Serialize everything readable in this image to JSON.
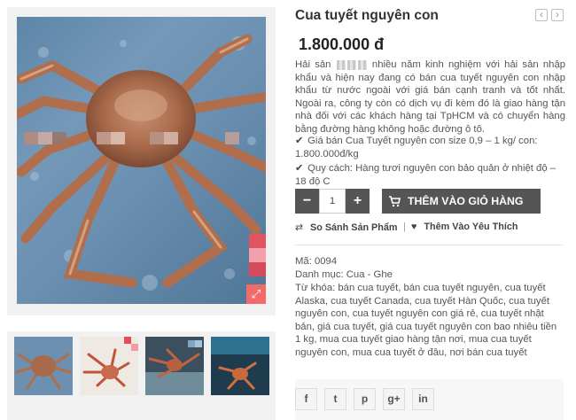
{
  "product": {
    "title": "Cua tuyết nguyên con",
    "price": "1.800.000 đ",
    "nav": {
      "prev": "‹",
      "next": "›"
    }
  },
  "description": {
    "part1": "Hải sản",
    "part2": "nhiều năm kinh nghiệm với hải sản nhập khẩu và hiện nay đang có bán cua tuyết nguyên con nhập khẩu từ nước ngoài với giá bán cạnh tranh và tốt nhất. Ngoài ra, công ty còn có dịch vụ đi kèm đó là giao hàng tận nhà đối với các khách hàng tại TpHCM và có chuyển hàng bằng đường hàng không hoặc đường ô tô."
  },
  "bullets": [
    {
      "icon": "check-icon",
      "text": "Giá bán Cua Tuyết nguyên con size 0,9 – 1 kg/ con: 1.800.000đ/kg"
    },
    {
      "icon": "check-icon",
      "text": "Quy cách: Hàng tươi nguyên con bảo quản ở nhiệt độ – 18 độ C"
    }
  ],
  "cart": {
    "minus": "−",
    "quantity": "1",
    "plus": "+",
    "add_label": "THÊM VÀO GIỎ HÀNG"
  },
  "actions": {
    "compare": "So Sánh Sản Phẩm",
    "separator": "|",
    "wishlist": "Thêm Vào Yêu Thích"
  },
  "meta": {
    "sku": "Mã: 0094",
    "category": "Danh mục: Cua - Ghe",
    "keywords": "Từ khóa: bán cua tuyết, bán cua tuyết nguyên, cua tuyết Alaska, cua tuyết Canada, cua tuyết Hàn Quốc, cua tuyết nguyên con, cua tuyết nguyên con giá rẻ, cua tuyết nhật bản, giá cua tuyết, giá cua tuyết nguyên con bao nhiêu tiền 1 kg, mua cua tuyết giao hàng tận nơi, mua cua tuyết nguyên con, mua cua tuyết ở đâu, nơi bán cua tuyết"
  },
  "share": [
    "f",
    "t",
    "p",
    "g+",
    "in"
  ],
  "icons": {
    "zoom": "expand-icon",
    "cart": "cart-icon",
    "compare": "retweet-icon",
    "wishlist": "heart-icon"
  },
  "colors": {
    "button_bg": "#555555",
    "zoom_accent": "#f16b6b",
    "gallery_bg": "#f1f1f1"
  }
}
